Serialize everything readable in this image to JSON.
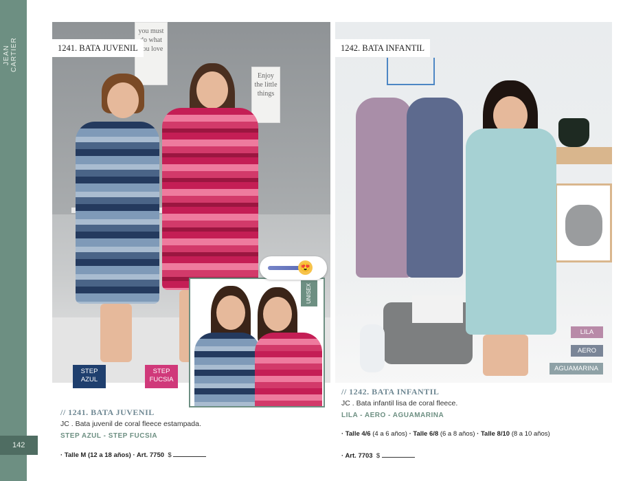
{
  "brand": "JEAN CARTIER",
  "page_number": "142",
  "left": {
    "photo_title": "1241. BATA JUVENIL",
    "wall_sign_1": "you must do what you love",
    "wall_sign_2": "Enjoy the little things",
    "label_azul": "STEP AZUL",
    "label_fucsia": "STEP FUCSIA",
    "unisex_label": "UNISEX",
    "emoji": "😍",
    "section_title": "// 1241. BATA JUVENIL",
    "description": "JC . Bata juvenil de coral fleece estampada.",
    "colors": "STEP AZUL - STEP FUCSIA",
    "size_prefix": "· Talle M",
    "size_range": "(12 a 18 años)",
    "art_label": "· Art. 7750",
    "price_symbol": "$"
  },
  "right": {
    "photo_title": "1242. BATA INFANTIL",
    "tag_lila": "LILA",
    "tag_aero": "AERO",
    "tag_aguamarina": "AGUAMARINA",
    "section_title": "// 1242. BATA INFANTIL",
    "description": "JC . Bata infantil lisa de coral fleece.",
    "colors": "LILA - AERO - AGUAMARINA",
    "size_1": "· Talle 4/6",
    "size_1_range": "(4 a 6 años)",
    "size_2": "· Talle 6/8",
    "size_2_range": "(6 a 8 años)",
    "size_3": "· Talle 8/10",
    "size_3_range": "(8 a 10 años)",
    "art_label": "· Art. 7703",
    "price_symbol": "$"
  },
  "colors": {
    "sidebar": "#6d8f82",
    "page_num_bg": "#4f6d62",
    "title_blue": "#6f8893",
    "accent_green": "#6d8f82",
    "label_navy": "#1f3f6e",
    "label_fucsia": "#d0397a",
    "tag_lila": "#b88aa8",
    "tag_aero": "#7a8597",
    "tag_aguamarina": "#8ea1a6"
  }
}
